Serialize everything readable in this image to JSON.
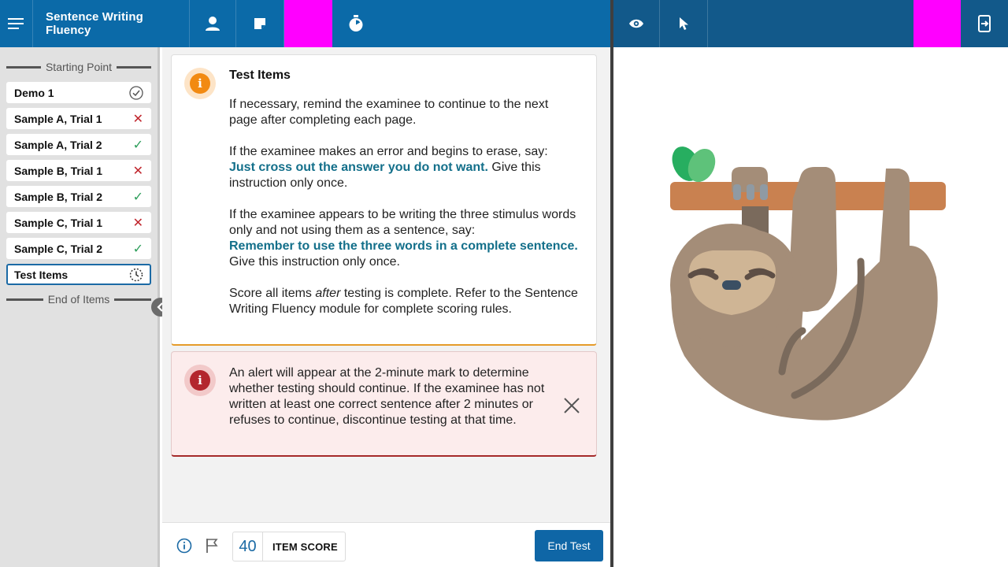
{
  "header": {
    "title": "Sentence Writing Fluency",
    "menu_icon": "hamburger-menu-icon",
    "examinee_icon": "person-icon",
    "notes_icon": "note-icon",
    "timer_icon": "stopwatch-icon",
    "preview_icon": "eye-icon",
    "pointer_icon": "pointer-icon",
    "exit_icon": "exit-screen-icon",
    "colors": {
      "left_bar": "#0b6aa8",
      "right_bar": "#12598a",
      "placeholder": "#ff00ff"
    }
  },
  "sidebar": {
    "start_label": "Starting Point",
    "end_label": "End of Items",
    "items": [
      {
        "label": "Demo 1",
        "status": "complete",
        "status_icon": "check-circle-icon"
      },
      {
        "label": "Sample A, Trial 1",
        "status": "incorrect",
        "status_icon": "x-icon"
      },
      {
        "label": "Sample A, Trial 2",
        "status": "correct",
        "status_icon": "check-icon"
      },
      {
        "label": "Sample B, Trial 1",
        "status": "incorrect",
        "status_icon": "x-icon"
      },
      {
        "label": "Sample B, Trial 2",
        "status": "correct",
        "status_icon": "check-icon"
      },
      {
        "label": "Sample C, Trial 1",
        "status": "incorrect",
        "status_icon": "x-icon"
      },
      {
        "label": "Sample C, Trial 2",
        "status": "correct",
        "status_icon": "check-icon"
      },
      {
        "label": "Test Items",
        "status": "in-progress",
        "status_icon": "timer-dotted-icon"
      }
    ]
  },
  "instructions": {
    "title": "Test Items",
    "p1": "If necessary, remind the examinee to continue to the next page after completing each page.",
    "p2_pre": "If the examinee makes an error and begins to erase, say:",
    "p2_bold": "Just cross out the answer you do not want.",
    "p2_post": " Give this instruction only once.",
    "p3_pre": "If the examinee appears to be writing the three stimulus words only and not using them as a sentence, say:",
    "p3_bold": "Remember to use the three words in a complete sentence.",
    "p3_post": " Give this instruction only once.",
    "p4_pre": "Score all items ",
    "p4_italic": "after",
    "p4_post": " testing is complete. Refer to the Sentence Writing Fluency module for complete scoring rules."
  },
  "alert": {
    "text": "An alert will appear at the 2-minute mark to determine whether testing should continue. If the examinee has not written at least one correct sentence after 2 minutes or refuses to continue, discontinue testing at that time."
  },
  "footer": {
    "score_value": "40",
    "score_label": "ITEM SCORE",
    "end_button": "End Test"
  }
}
